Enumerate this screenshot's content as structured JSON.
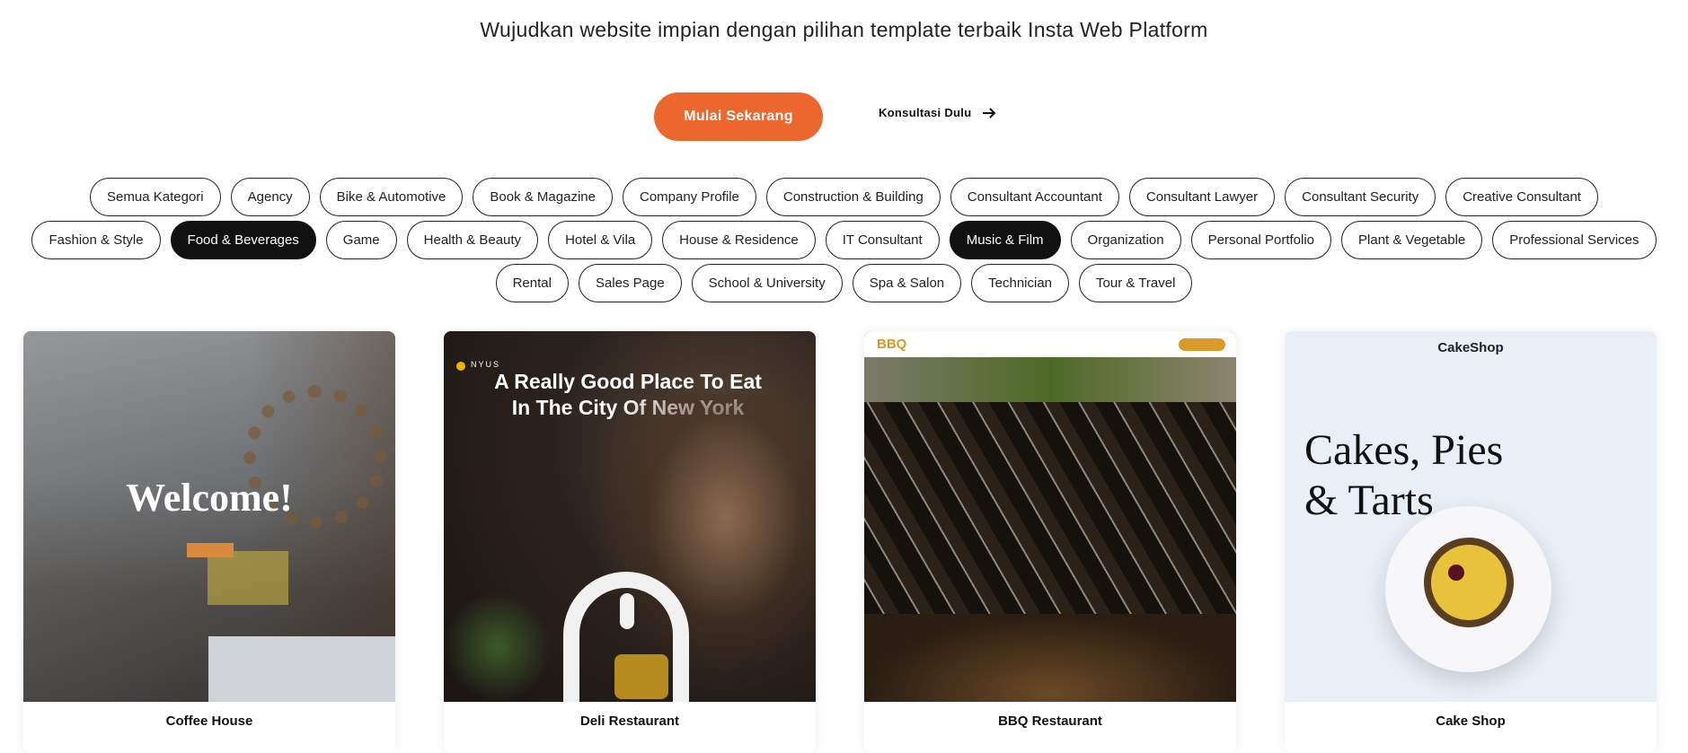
{
  "header": {
    "title": "Wujudkan website impian dengan pilihan template terbaik Insta Web Platform"
  },
  "actions": {
    "primary_label": "Mulai Sekarang",
    "primary_color": "#ec672e",
    "secondary_label": "Konsultasi Dulu",
    "secondary_icon": "arrow-right-icon"
  },
  "categories": {
    "rows": [
      [
        "Semua Kategori",
        "Agency",
        "Bike & Automotive",
        "Book & Magazine",
        "Company Profile",
        "Construction & Building",
        "Consultant Accountant",
        "Consultant Lawyer",
        "Consultant Security",
        "Creative Consultant"
      ],
      [
        "Fashion & Style",
        "Food & Beverages",
        "Game",
        "Health & Beauty",
        "Hotel & Vila",
        "House & Residence",
        "IT Consultant",
        "Music & Film",
        "Organization",
        "Personal Portfolio",
        "Plant & Vegetable",
        "Professional Services"
      ],
      [
        "Rental",
        "Sales Page",
        "School & University",
        "Spa & Salon",
        "Technician",
        "Tour & Travel"
      ]
    ],
    "active": [
      "Food & Beverages",
      "Music & Film"
    ]
  },
  "templates": [
    {
      "name": "Coffee House",
      "preview_heading": "Welcome!"
    },
    {
      "name": "Deli Restaurant",
      "preview_brand": "NYUS",
      "preview_heading": "A Really Good Place To Eat In The City Of New York"
    },
    {
      "name": "BBQ Restaurant",
      "preview_brand": "BBQ"
    },
    {
      "name": "Cake Shop",
      "preview_brand": "CakeShop",
      "preview_heading": "Cakes, Pies & Tarts"
    }
  ]
}
